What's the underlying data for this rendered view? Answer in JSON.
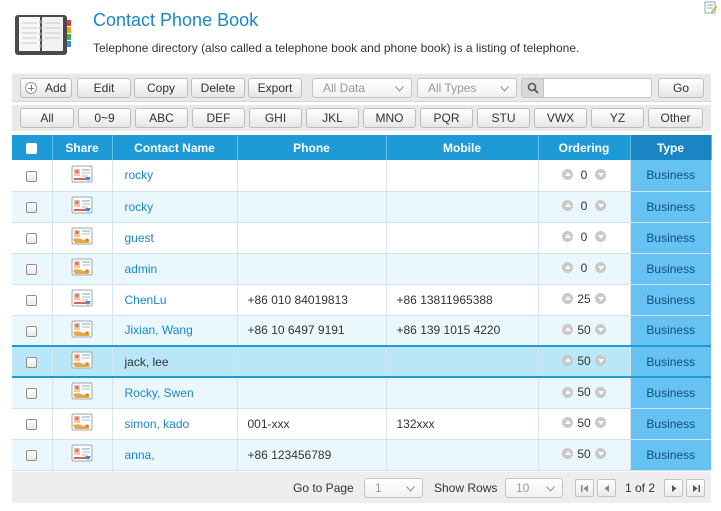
{
  "header": {
    "title": "Contact Phone Book",
    "subtitle": "Telephone directory (also called a telephone book and phone book) is a listing of telephone."
  },
  "toolbar": {
    "add_label": "Add",
    "edit_label": "Edit",
    "copy_label": "Copy",
    "delete_label": "Delete",
    "export_label": "Export",
    "data_select": "All Data",
    "types_select": "All Types",
    "search_value": "",
    "go_label": "Go"
  },
  "alphabet": [
    "All",
    "0~9",
    "ABC",
    "DEF",
    "GHI",
    "JKL",
    "MNO",
    "PQR",
    "STU",
    "VWX",
    "YZ",
    "Other"
  ],
  "columns": {
    "share": "Share",
    "name": "Contact Name",
    "phone": "Phone",
    "mobile": "Mobile",
    "ordering": "Ordering",
    "type": "Type"
  },
  "rows": [
    {
      "name": "rocky",
      "phone": "",
      "mobile": "",
      "ordering": "0",
      "type": "Business",
      "icon": "contact-card-icon"
    },
    {
      "name": "rocky",
      "phone": "",
      "mobile": "",
      "ordering": "0",
      "type": "Business",
      "icon": "contact-card-icon"
    },
    {
      "name": "guest",
      "phone": "",
      "mobile": "",
      "ordering": "0",
      "type": "Business",
      "icon": "shared-contact-icon"
    },
    {
      "name": "admin",
      "phone": "",
      "mobile": "",
      "ordering": "0",
      "type": "Business",
      "icon": "shared-contact-icon"
    },
    {
      "name": "ChenLu",
      "phone": "+86 010 84019813",
      "mobile": "+86 13811965388",
      "ordering": "25",
      "type": "Business",
      "icon": "contact-card-icon"
    },
    {
      "name": "Jixian, Wang",
      "phone": "+86 10 6497 9191",
      "mobile": "+86 139 1015 4220",
      "ordering": "50",
      "type": "Business",
      "icon": "shared-contact-icon"
    },
    {
      "name": "jack, lee",
      "phone": "",
      "mobile": "",
      "ordering": "50",
      "type": "Business",
      "icon": "shared-contact-icon",
      "selected": true
    },
    {
      "name": "Rocky, Swen",
      "phone": "",
      "mobile": "",
      "ordering": "50",
      "type": "Business",
      "icon": "shared-contact-icon"
    },
    {
      "name": "simon, kado",
      "phone": "001-xxx",
      "mobile": "132xxx",
      "ordering": "50",
      "type": "Business",
      "icon": "shared-contact-icon"
    },
    {
      "name": "anna,",
      "phone": "+86 123456789",
      "mobile": "",
      "ordering": "50",
      "type": "Business",
      "icon": "contact-card-icon"
    }
  ],
  "pager": {
    "goto_label": "Go to Page",
    "page_value": "1",
    "rows_label": "Show Rows",
    "rows_value": "10",
    "page_status": "1 of 2"
  },
  "colors": {
    "header_blue": "#1e9ad6",
    "type_cell": "#66c2f2",
    "selected_row": "#b9e7f9",
    "link": "#1a86c8"
  }
}
